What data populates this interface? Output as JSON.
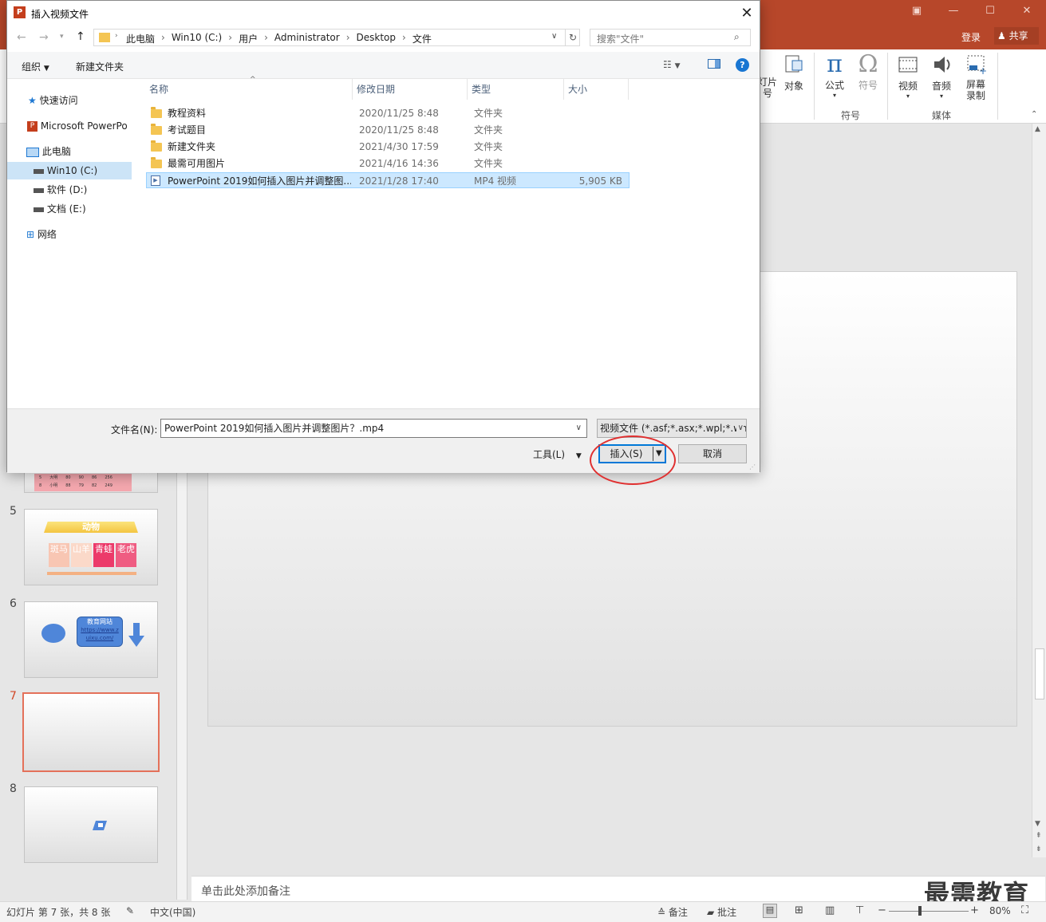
{
  "powerpoint": {
    "sign_in": "登录",
    "share": "共享",
    "ribbon": {
      "partial_button_1": "灯片\n号",
      "object": "对象",
      "equation": "公式",
      "symbol": "符号",
      "group_symbols": "符号",
      "video": "视频",
      "audio": "音频",
      "screen_recording": "屏幕\n录制",
      "group_media": "媒体"
    },
    "thumbnails": [
      {
        "num": "5",
        "title": "动物",
        "cells": [
          "斑马",
          "山羊",
          "青蛙",
          "老虎"
        ]
      },
      {
        "num": "6",
        "box_title": "教育网站",
        "link": "https://www.zuixu.com/"
      },
      {
        "num": "7"
      },
      {
        "num": "8"
      }
    ],
    "thumb4_partial_rows": [
      [
        "5",
        "大明",
        "80",
        "90",
        "86",
        "256"
      ],
      [
        "8",
        "小明",
        "88",
        "79",
        "82",
        "249"
      ]
    ],
    "notes_placeholder": "单击此处添加备注",
    "status": {
      "slide_info": "幻灯片 第 7 张，共 8 张",
      "language": "中文(中国)",
      "notes": "备注",
      "comments": "批注",
      "zoom": "80%"
    },
    "watermark": "最需教育"
  },
  "dialog": {
    "title": "插入视频文件",
    "breadcrumb": [
      "此电脑",
      "Win10 (C:)",
      "用户",
      "Administrator",
      "Desktop",
      "文件"
    ],
    "search_placeholder": "搜索\"文件\"",
    "toolbar": {
      "organize": "组织",
      "new_folder": "新建文件夹"
    },
    "nav": [
      {
        "label": "快速访问",
        "icon": "star-icon"
      },
      {
        "label": "Microsoft PowerPo",
        "icon": "powerpoint-icon"
      },
      {
        "label": "此电脑",
        "icon": "computer-icon"
      },
      {
        "label": "Win10 (C:)",
        "icon": "drive-icon"
      },
      {
        "label": "软件 (D:)",
        "icon": "drive-icon"
      },
      {
        "label": "文档 (E:)",
        "icon": "drive-icon"
      },
      {
        "label": "网络",
        "icon": "network-icon"
      }
    ],
    "columns": {
      "name": "名称",
      "date": "修改日期",
      "type": "类型",
      "size": "大小"
    },
    "files": [
      {
        "name": "教程资料",
        "date": "2020/11/25 8:48",
        "type": "文件夹",
        "size": ""
      },
      {
        "name": "考试题目",
        "date": "2020/11/25 8:48",
        "type": "文件夹",
        "size": ""
      },
      {
        "name": "新建文件夹",
        "date": "2021/4/30 17:59",
        "type": "文件夹",
        "size": ""
      },
      {
        "name": "最需可用图片",
        "date": "2021/4/16 14:36",
        "type": "文件夹",
        "size": ""
      },
      {
        "name": "PowerPoint 2019如何插入图片并调整图...",
        "date": "2021/1/28 17:40",
        "type": "MP4 视频",
        "size": "5,905 KB"
      }
    ],
    "filename_label": "文件名(N):",
    "filename_value": "PowerPoint 2019如何插入图片并调整图片？.mp4",
    "filter": "视频文件 (*.asf;*.asx;*.wpl;*.wm",
    "tools": "工具(L)",
    "insert": "插入(S)",
    "cancel": "取消"
  }
}
